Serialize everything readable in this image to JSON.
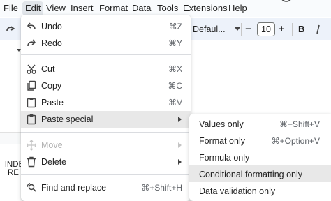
{
  "menubar": {
    "items": [
      {
        "label": "File"
      },
      {
        "label": "Edit"
      },
      {
        "label": "View"
      },
      {
        "label": "Insert"
      },
      {
        "label": "Format"
      },
      {
        "label": "Data"
      },
      {
        "label": "Tools"
      },
      {
        "label": "Extensions"
      },
      {
        "label": "Help"
      }
    ],
    "active_item": "Edit"
  },
  "toolbar": {
    "font_name": "Defaul...",
    "font_size": "10",
    "minus": "−",
    "plus": "+",
    "bold": "B"
  },
  "sheet": {
    "cell_line1": "=INDE",
    "cell_line2": "RE"
  },
  "edit_menu": {
    "undo": {
      "label": "Undo",
      "shortcut": "⌘Z"
    },
    "redo": {
      "label": "Redo",
      "shortcut": "⌘Y"
    },
    "cut": {
      "label": "Cut",
      "shortcut": "⌘X"
    },
    "copy": {
      "label": "Copy",
      "shortcut": "⌘C"
    },
    "paste": {
      "label": "Paste",
      "shortcut": "⌘V"
    },
    "paste_special": {
      "label": "Paste special"
    },
    "move": {
      "label": "Move",
      "disabled": true
    },
    "delete": {
      "label": "Delete"
    },
    "find_replace": {
      "label": "Find and replace",
      "shortcut": "⌘+Shift+H"
    }
  },
  "paste_special_submenu": {
    "items": [
      {
        "label": "Values only",
        "shortcut": "⌘+Shift+V"
      },
      {
        "label": "Format only",
        "shortcut": "⌘+Option+V"
      },
      {
        "label": "Formula only",
        "shortcut": ""
      },
      {
        "label": "Conditional formatting only",
        "shortcut": ""
      },
      {
        "label": "Data validation only",
        "shortcut": ""
      }
    ],
    "hovered": "Conditional formatting only"
  },
  "colors": {
    "menubar_bg": "#f9fbfd",
    "toolbar_bg": "#edf2fa",
    "hover_bg": "#e8e8e8",
    "disabled_text": "#b4b4b4",
    "shortcut_text": "#5f6368"
  }
}
